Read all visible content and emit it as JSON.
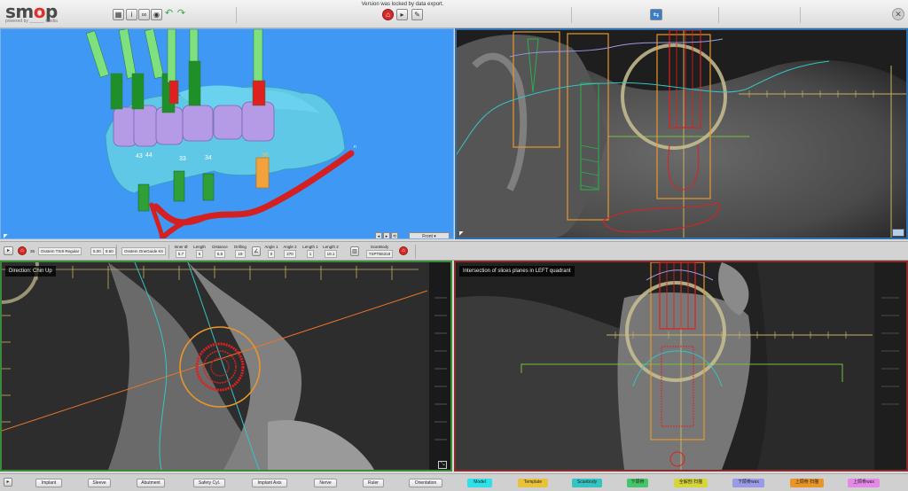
{
  "app": {
    "logo_prefix": "sm",
    "logo_o": "o",
    "logo_suffix": "p",
    "logo_sub": "powered by ______ media",
    "lock_message": "Version was locked by data export."
  },
  "axial_view": {
    "tooth_numbers": [
      "43",
      "44",
      "33",
      "34",
      "36"
    ]
  },
  "sagittal_view": {
    "title": "Direction: Chin Up"
  },
  "coronal_view": {
    "title": "Intersection of slices planes in LEFT quadrant"
  },
  "view3d_controls": {
    "view_select": "Front"
  },
  "implant_bar": {
    "tooth": "36",
    "implant_name": "Osstem TSIII Regular",
    "diameter": "5.00",
    "length": "8.50",
    "kit": "Osstem OneGuide Kit",
    "fields": [
      {
        "label": "Inner Ø",
        "value": "5.7"
      },
      {
        "label": "Length",
        "value": "5"
      },
      {
        "label": "Distance",
        "value": "5.5"
      },
      {
        "label": "Drilling",
        "value": "19"
      },
      {
        "label": "Angle 1",
        "value": "0"
      },
      {
        "label": "Angle 2",
        "value": "270"
      },
      {
        "label": "Length 1",
        "value": "1"
      },
      {
        "label": "Length 2",
        "value": "19.1"
      }
    ],
    "scanbody_label": "ScanBody",
    "scanbody_value": "TSPTB6318"
  },
  "bottom_left_buttons": [
    "Implant",
    "Sleeve",
    "Abutment",
    "Safety Cyl.",
    "Implant Axis",
    "Nerve",
    "Ruler",
    "Orientation"
  ],
  "bottom_right_buttons": [
    {
      "label": "Model",
      "color": "#2ee0e8"
    },
    {
      "label": "Template",
      "color": "#e8c23a"
    },
    {
      "label": "Scanbody",
      "color": "#35c4c4"
    },
    {
      "label": "下颌骨",
      "color": "#46c46a"
    },
    {
      "label": "全解剖 扫描",
      "color": "#d6d63a"
    },
    {
      "label": "下颌骨wax",
      "color": "#9a9ae6"
    },
    {
      "label": "上颌骨 扫描",
      "color": "#e8962a"
    },
    {
      "label": "上颌骨wax",
      "color": "#e28ae6"
    }
  ],
  "colors": {
    "viewport_3d_bg": "#3f98f4",
    "axial_border": "#2f6fb0",
    "sagittal_border": "#3a8a3a",
    "coronal_border": "#8a2a2a"
  }
}
